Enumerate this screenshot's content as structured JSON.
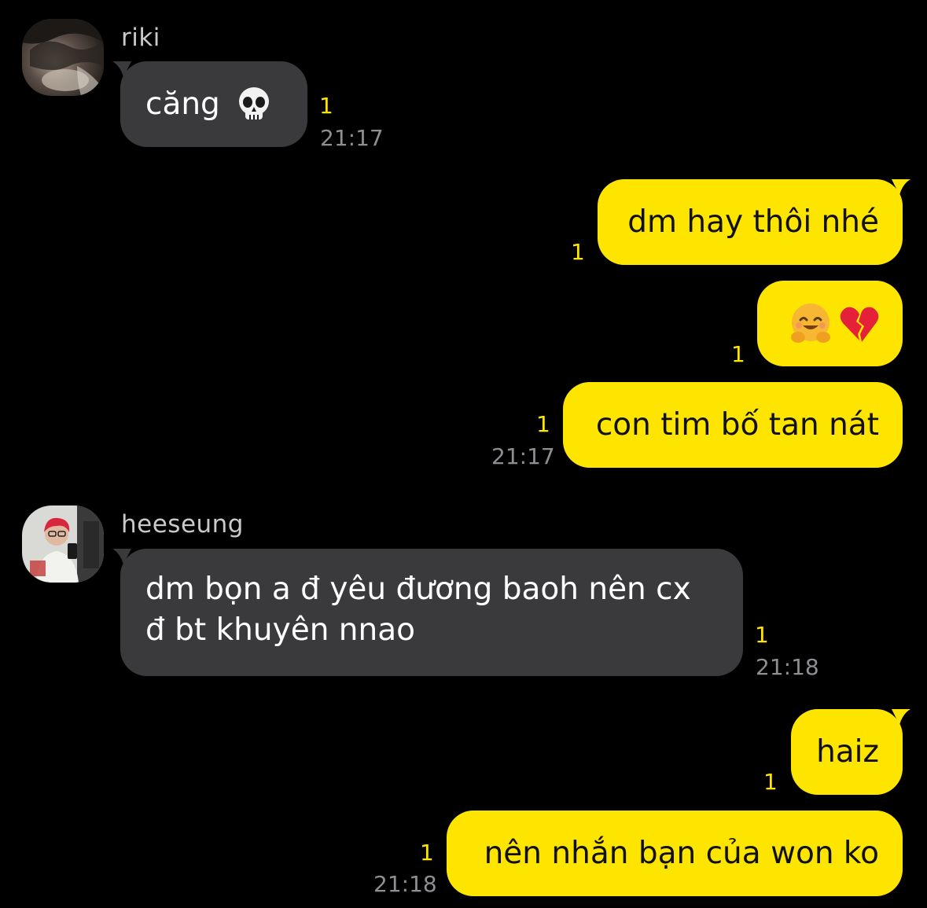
{
  "colors": {
    "background": "#000000",
    "incoming_bubble": "#3a3a3c",
    "outgoing_bubble": "#fee500",
    "unread_count": "#fee500",
    "timestamp": "#8e8e93"
  },
  "messages": [
    {
      "sender": "riki",
      "avatar_icon": "riki-avatar-photo",
      "text": "căng",
      "emoji": "skull-emoji",
      "unread": "1",
      "time": "21:17"
    },
    {
      "text": "dm hay thôi nhé",
      "unread": "1"
    },
    {
      "emoji_a": "hugging-face-emoji",
      "emoji_b": "broken-heart-emoji",
      "unread": "1"
    },
    {
      "text": "con tim bố tan nát",
      "unread": "1",
      "time": "21:17"
    },
    {
      "sender": "heeseung",
      "avatar_icon": "heeseung-avatar-photo",
      "text": "dm bọn a đ yêu đương baoh nên cx đ bt khuyên nnao",
      "unread": "1",
      "time": "21:18"
    },
    {
      "text": "haiz",
      "unread": "1"
    },
    {
      "text": "nên nhắn bạn của won ko",
      "unread": "1",
      "time": "21:18"
    }
  ]
}
